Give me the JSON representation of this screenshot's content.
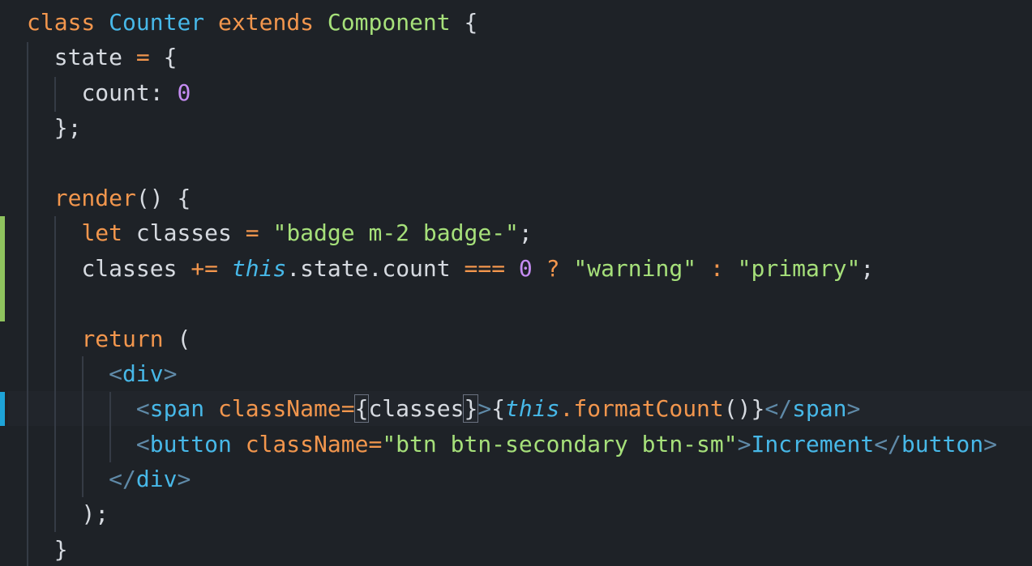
{
  "editor": {
    "theme": {
      "background": "#1e2227",
      "keyword": "#f2964d",
      "class_name": "#47b8e8",
      "string": "#a6e07a",
      "number": "#c58cf2",
      "plain": "#d6dae0",
      "git_added": "#8fc35e",
      "git_modified": "#1ea4d8"
    },
    "tokens": {
      "kw_class": "class",
      "cls_counter": "Counter",
      "kw_extends": "extends",
      "base_component": "Component",
      "open_brace": " {",
      "prop_state": "state",
      "eq": "=",
      "obj_open": "{",
      "key_count": "count",
      "colon": ":",
      "zero": "0",
      "obj_close": "};",
      "fn_render": "render",
      "render_paren": "() {",
      "kw_let": "let",
      "var_classes": "classes",
      "str_badge": "\"badge m-2 badge-\"",
      "semi": ";",
      "plus_eq": "+=",
      "kw_this": "this",
      "state_count": ".state.count",
      "triple_eq": "===",
      "q": "?",
      "str_warning": "\"warning\"",
      "str_primary": "\"primary\"",
      "kw_return": "return",
      "paren_open": "(",
      "lt": "<",
      "gt": ">",
      "lt_slash": "</",
      "tag_div": "div",
      "tag_span": "span",
      "tag_button": "button",
      "attr_classname": "className",
      "brace_l": "{",
      "brace_r": "}",
      "dot_format": ".formatCount",
      "call_parens": "()",
      "str_btn": "\"btn btn-secondary btn-sm\"",
      "text_increment": "Increment",
      "paren_close": ");",
      "close_brace": "}"
    }
  }
}
